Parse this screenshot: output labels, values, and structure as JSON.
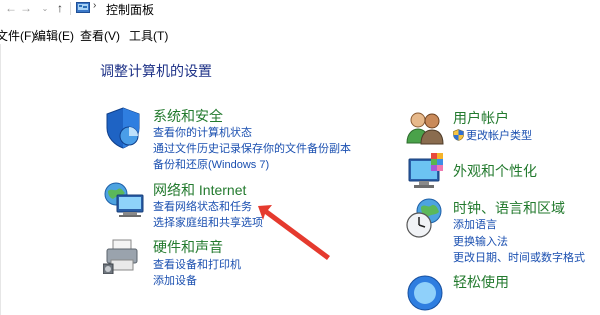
{
  "address_bar": {
    "breadcrumb": "控制面板",
    "back_icon": "back-arrow-icon",
    "forward_icon": "forward-arrow-icon",
    "recent_icon": "chevron-down-icon",
    "up_icon": "up-arrow-icon"
  },
  "menu": {
    "file": "文件(F)",
    "edit": "编辑(E)",
    "view": "查看(V)",
    "tools": "工具(T)"
  },
  "page_title": "调整计算机的设置",
  "categories": {
    "system_security": {
      "title": "系统和安全",
      "links": [
        "查看你的计算机状态",
        "通过文件历史记录保存你的文件备份副本",
        "备份和还原(Windows 7)"
      ]
    },
    "network_internet": {
      "title": "网络和 Internet",
      "links": [
        "查看网络状态和任务",
        "选择家庭组和共享选项"
      ]
    },
    "hardware_sound": {
      "title": "硬件和声音",
      "links": [
        "查看设备和打印机",
        "添加设备"
      ]
    },
    "user_accounts": {
      "title": "用户帐户",
      "links": [
        "更改帐户类型"
      ]
    },
    "appearance": {
      "title": "外观和个性化",
      "links": []
    },
    "clock_region": {
      "title": "时钟、语言和区域",
      "links": [
        "添加语言",
        "更换输入法",
        "更改日期、时间或数字格式"
      ]
    },
    "ease_of_access": {
      "title": "轻松使用",
      "links": []
    }
  },
  "colors": {
    "category_title": "#237a2e",
    "link": "#1a4fb0",
    "page_title": "#1e3287",
    "annotation_arrow": "#e53a2e"
  }
}
